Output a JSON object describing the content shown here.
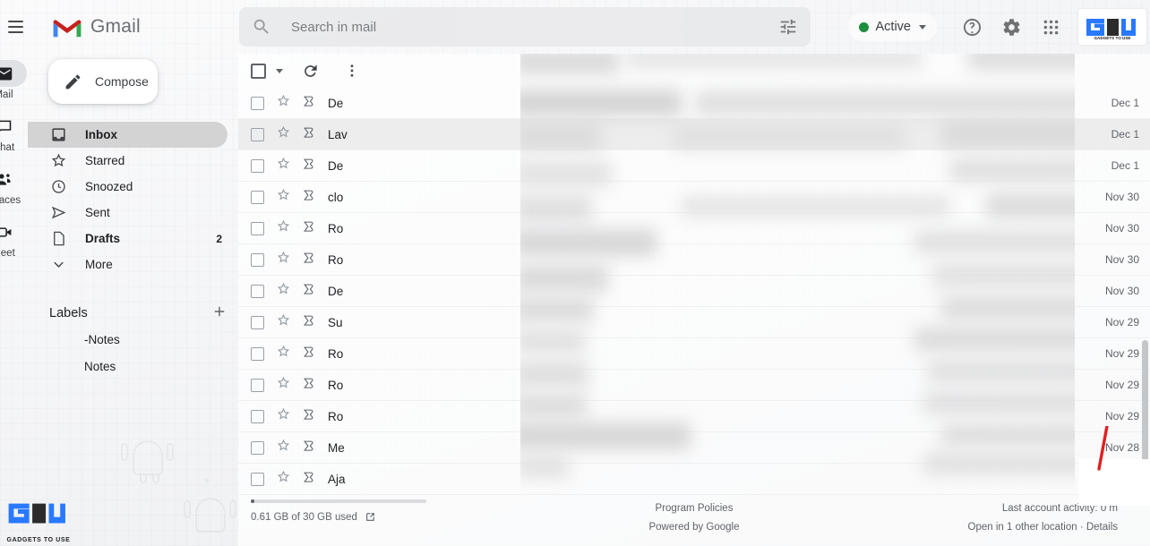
{
  "app": {
    "brand": "Gmail",
    "menu_icon": "hamburger-icon",
    "logo_icon": "gmail-m-logo"
  },
  "search": {
    "placeholder": "Search in mail",
    "value": "",
    "search_icon": "search-icon",
    "filter_icon": "tune-filter-icon"
  },
  "header_right": {
    "status_label": "Active",
    "status_color": "#1e8e3e",
    "help_icon": "help-circle-icon",
    "settings_icon": "gear-icon",
    "apps_icon": "apps-grid-icon",
    "logo_text": "GADGETS TO USE"
  },
  "rail": {
    "items": [
      {
        "label": "Mail",
        "icon": "mail-envelope-icon",
        "active": true
      },
      {
        "label": "Chat",
        "icon": "chat-bubble-icon",
        "active": false
      },
      {
        "label": "Spaces",
        "icon": "spaces-people-icon",
        "active": false
      },
      {
        "label": "Meet",
        "icon": "meet-video-icon",
        "active": false
      }
    ]
  },
  "sidebar": {
    "compose_label": "Compose",
    "compose_icon": "pencil-icon",
    "nav": [
      {
        "label": "Inbox",
        "icon": "inbox-icon",
        "count": "",
        "active": true
      },
      {
        "label": "Starred",
        "icon": "star-icon",
        "count": "",
        "active": false
      },
      {
        "label": "Snoozed",
        "icon": "clock-icon",
        "count": "",
        "active": false
      },
      {
        "label": "Sent",
        "icon": "send-arrow-icon",
        "count": "",
        "active": false
      },
      {
        "label": "Drafts",
        "icon": "draft-file-icon",
        "count": "2",
        "active": false,
        "bold": true
      },
      {
        "label": "More",
        "icon": "chevron-down-icon",
        "count": "",
        "active": false
      }
    ],
    "labels_title": "Labels",
    "add_label_icon": "plus-icon",
    "labels": [
      {
        "label": "-Notes",
        "color": "#3f7ee8"
      },
      {
        "label": "Notes",
        "color": "#3c4043"
      }
    ]
  },
  "list_toolbar": {
    "select_all_icon": "checkbox-icon",
    "select_caret_icon": "chevron-down-icon",
    "refresh_icon": "refresh-icon",
    "more_icon": "more-vertical-icon"
  },
  "mail_rows": [
    {
      "sender": "De",
      "date": "Dec 1",
      "hovered": false
    },
    {
      "sender": "Lav",
      "date": "Dec 1",
      "hovered": true
    },
    {
      "sender": "De",
      "date": "Dec 1",
      "hovered": false
    },
    {
      "sender": "clo",
      "date": "Nov 30",
      "hovered": false
    },
    {
      "sender": "Ro",
      "date": "Nov 30",
      "hovered": false
    },
    {
      "sender": "Ro",
      "date": "Nov 30",
      "hovered": false
    },
    {
      "sender": "De",
      "date": "Nov 30",
      "hovered": false
    },
    {
      "sender": "Su",
      "date": "Nov 29",
      "hovered": false
    },
    {
      "sender": "Ro",
      "date": "Nov 29",
      "hovered": false
    },
    {
      "sender": "Ro",
      "date": "Nov 29",
      "hovered": false
    },
    {
      "sender": "Ro",
      "date": "Nov 29",
      "hovered": false
    },
    {
      "sender": "Me",
      "date": "Nov 28",
      "hovered": false
    },
    {
      "sender": "Aja",
      "date": "",
      "hovered": false
    }
  ],
  "footer": {
    "storage_text": "0.61 GB of 30 GB used",
    "storage_percent": 2,
    "storage_link_icon": "external-link-icon",
    "program_policies": "Program Policies",
    "powered_by": "Powered by Google",
    "last_activity": "Last account activity: 0 m",
    "other_location": "Open in 1 other location · Details"
  },
  "annotation": {
    "color": "#e02020",
    "kind": "red-pointer-line"
  }
}
